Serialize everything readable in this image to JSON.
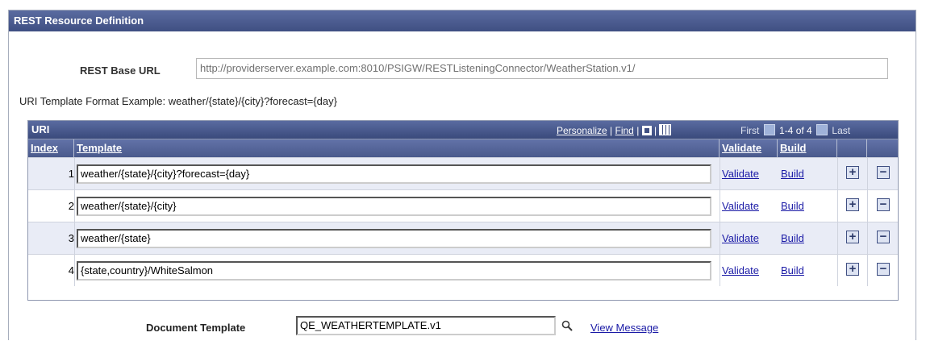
{
  "panel": {
    "title": "REST Resource Definition"
  },
  "base_url": {
    "label": "REST Base URL",
    "value": "http://providerserver.example.com:8010/PSIGW/RESTListeningConnector/WeatherStation.v1/"
  },
  "example_text": "URI Template Format Example: weather/{state}/{city}?forecast={day}",
  "grid": {
    "title": "URI",
    "personalize": "Personalize",
    "find": "Find",
    "separator": "|",
    "first": "First",
    "range": "1-4 of 4",
    "last": "Last",
    "columns": {
      "index": "Index",
      "template": "Template",
      "validate": "Validate",
      "build": "Build"
    },
    "rows": [
      {
        "index": "1",
        "template": "weather/{state}/{city}?forecast={day}",
        "validate": "Validate",
        "build": "Build"
      },
      {
        "index": "2",
        "template": "weather/{state}/{city}",
        "validate": "Validate",
        "build": "Build"
      },
      {
        "index": "3",
        "template": "weather/{state}",
        "validate": "Validate",
        "build": "Build"
      },
      {
        "index": "4",
        "template": "{state,country}/WhiteSalmon",
        "validate": "Validate",
        "build": "Build"
      }
    ],
    "add_symbol": "+",
    "remove_symbol": "−"
  },
  "document_template": {
    "label": "Document Template",
    "value": "QE_WEATHERTEMPLATE.v1",
    "view_message": "View Message"
  },
  "colors": {
    "header": "#4a5a8c",
    "link": "#1a1aa6",
    "alt_row": "#e9ecf6"
  }
}
